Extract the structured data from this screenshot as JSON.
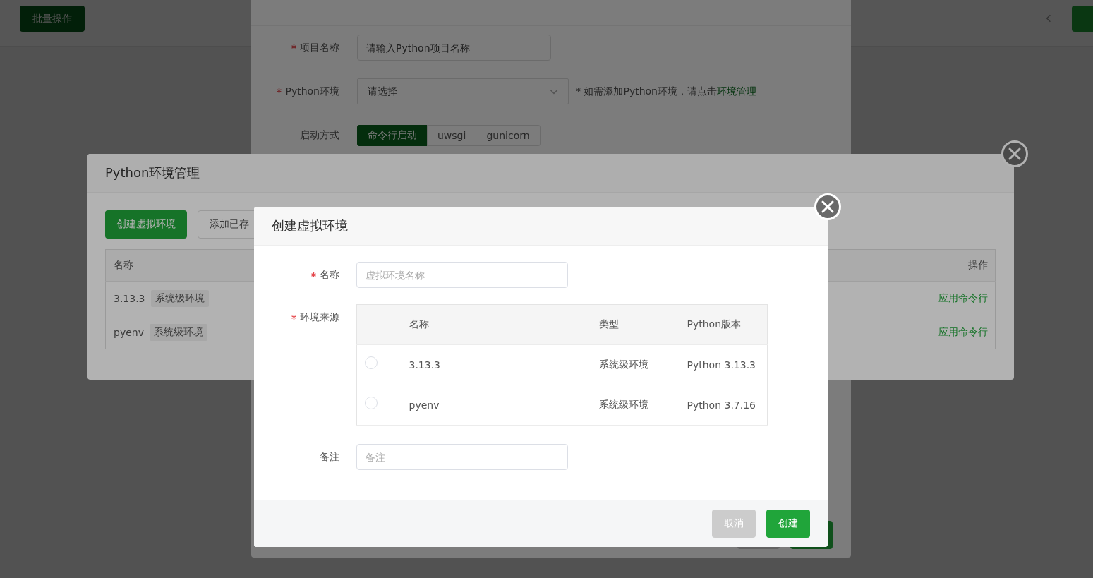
{
  "page": {
    "toolbar_button": "批量操作"
  },
  "project_dialog": {
    "fields": [
      {
        "kind": "input",
        "label": "项目名称",
        "required": true,
        "placeholder": "请输入Python项目名称"
      },
      {
        "kind": "select",
        "label": "Python环境",
        "required": true,
        "placeholder": "请选择",
        "hint": "* 如需添加Python环境，请点击",
        "hint_link": "环境管理"
      },
      {
        "kind": "segmented",
        "label": "启动方式",
        "required": false,
        "options": [
          {
            "label": "命令行启动",
            "selected": true
          },
          {
            "label": "uwsgi",
            "selected": false
          },
          {
            "label": "gunicorn",
            "selected": false
          }
        ]
      }
    ]
  },
  "env_dialog": {
    "title": "Python环境管理",
    "buttons": [
      {
        "label": "创建虚拟环境",
        "kind": "primary"
      },
      {
        "label": "添加已存",
        "kind": "default"
      }
    ],
    "table": {
      "columns": [
        "名称",
        "操作"
      ],
      "rows": [
        {
          "name": "3.13.3",
          "tag": "系统级环境",
          "action": "应用命令行"
        },
        {
          "name": "pyenv",
          "tag": "系统级环境",
          "action": "应用命令行"
        }
      ]
    }
  },
  "venv_dialog": {
    "title": "创建虚拟环境",
    "name_field": {
      "label": "名称",
      "required": true,
      "placeholder": "虚拟环境名称"
    },
    "source": {
      "label": "环境来源",
      "required": true,
      "columns": [
        "名称",
        "类型",
        "Python版本"
      ],
      "rows": [
        {
          "name": "3.13.3",
          "type": "系统级环境",
          "version": "Python 3.13.3",
          "selected": false
        },
        {
          "name": "pyenv",
          "type": "系统级环境",
          "version": "Python 3.7.16",
          "selected": false
        }
      ]
    },
    "note_field": {
      "label": "备注",
      "required": false,
      "placeholder": "备注"
    },
    "buttons": [
      {
        "label": "取消",
        "kind": "cancel"
      },
      {
        "label": "创建",
        "kind": "primary"
      }
    ]
  }
}
